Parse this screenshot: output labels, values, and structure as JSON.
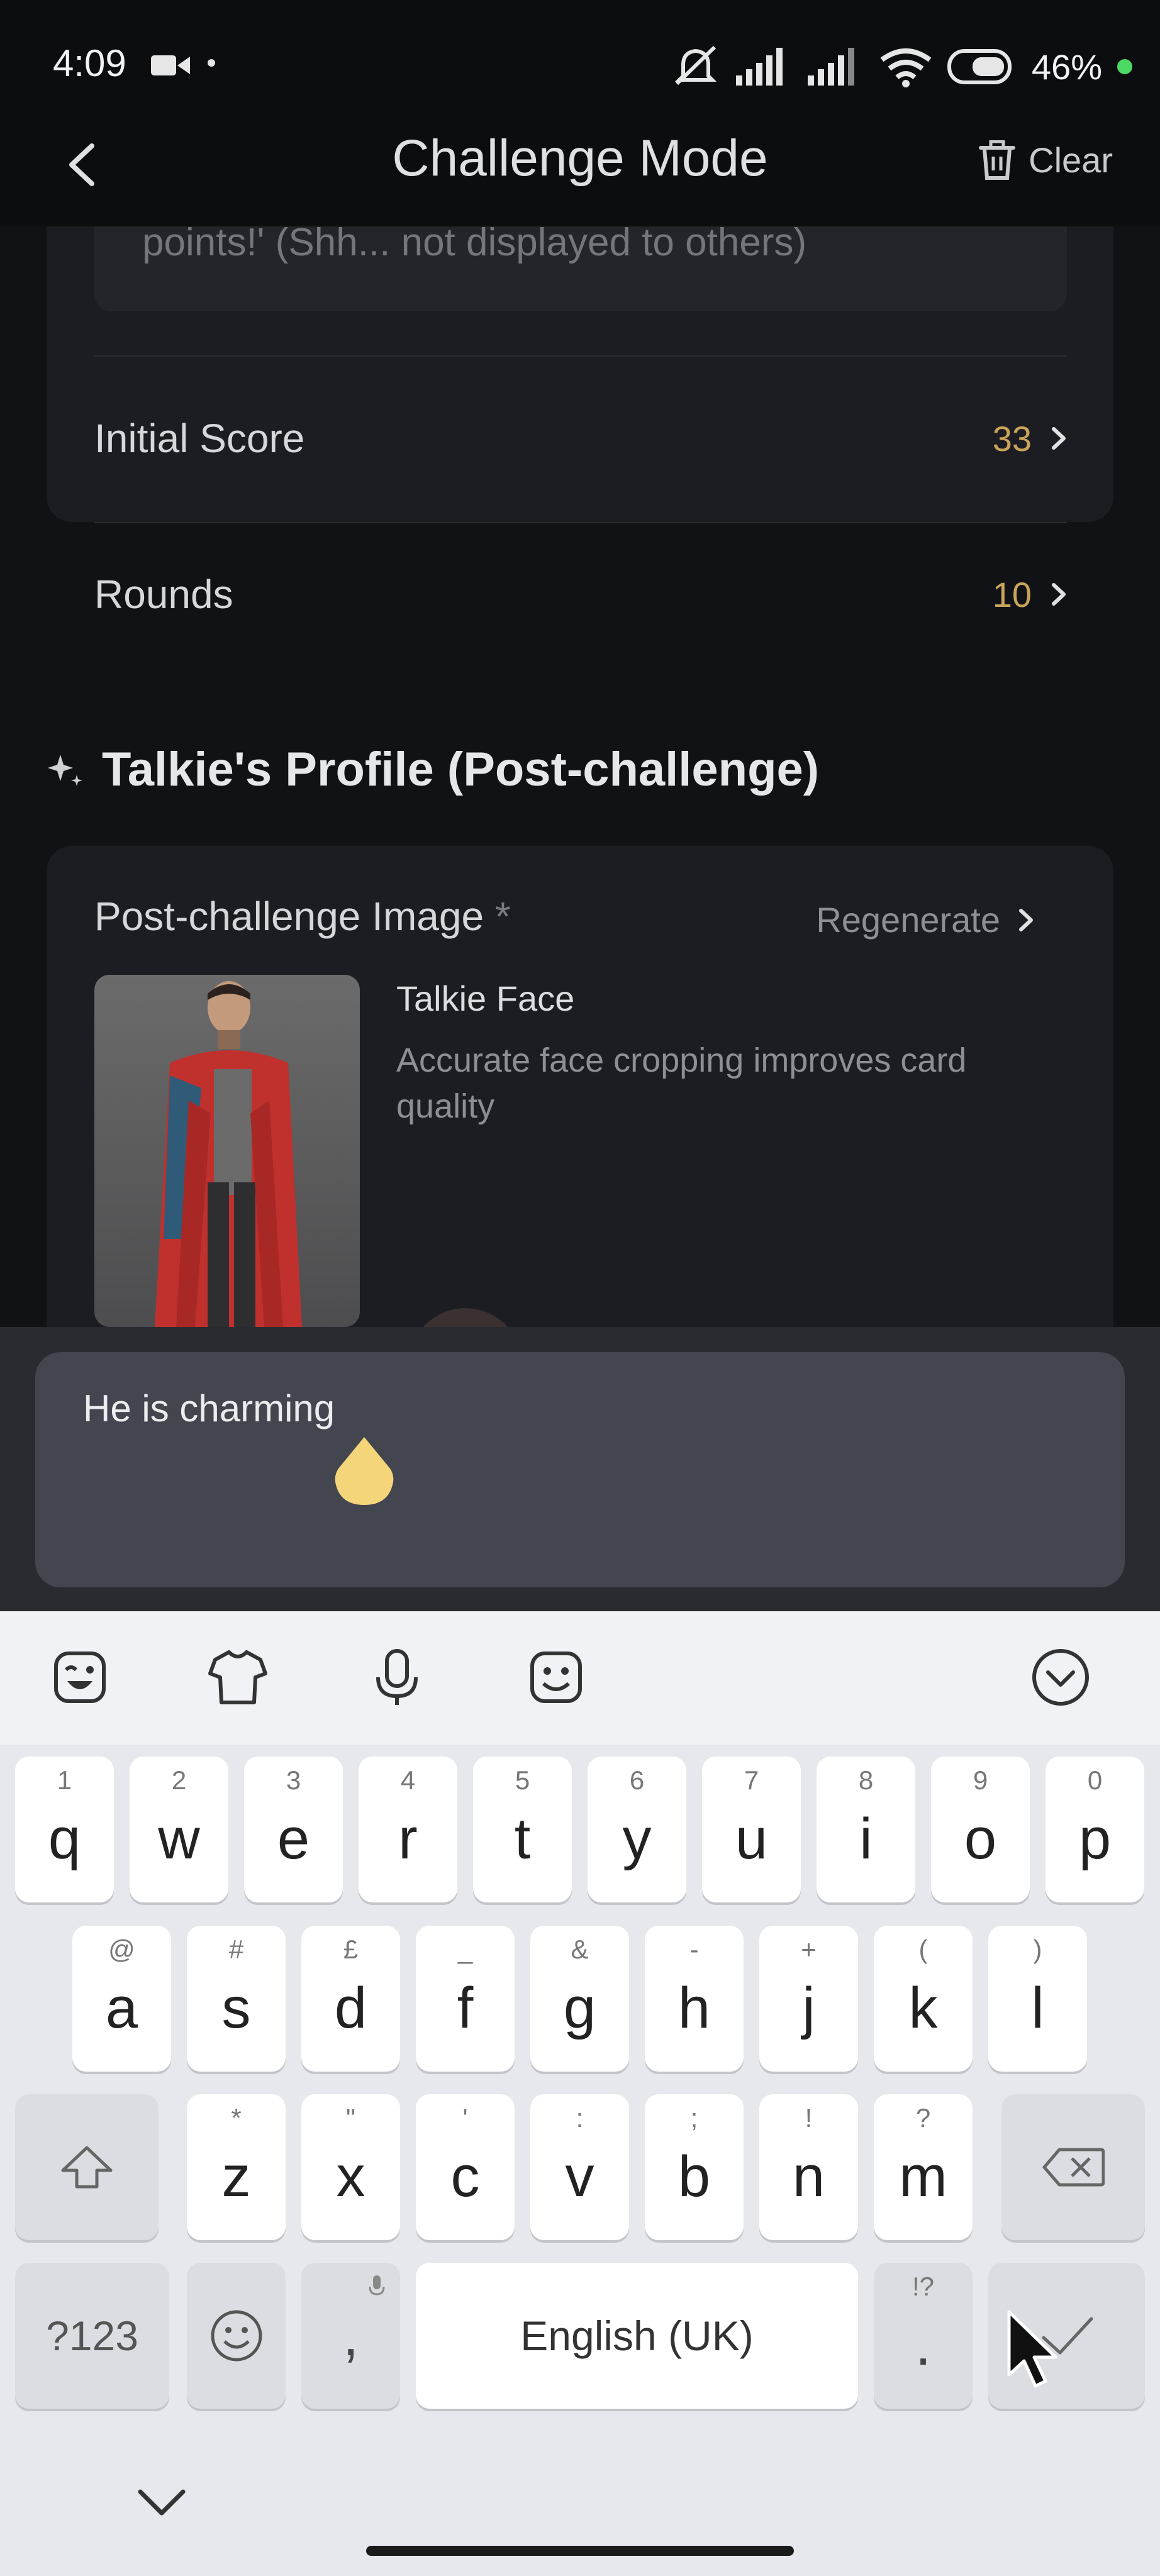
{
  "status_bar": {
    "time": "4:09",
    "battery": "46%",
    "icons": [
      "video-icon",
      "mute-icon",
      "signal-icon",
      "signal-icon",
      "wifi-icon",
      "battery-icon"
    ]
  },
  "header": {
    "title": "Challenge Mode",
    "clear_label": "Clear",
    "icons": [
      "back-icon",
      "trash-icon"
    ]
  },
  "content": {
    "hint_text": "points!' (Shh... not displayed to others)",
    "settings": [
      {
        "label": "Initial Score",
        "value": "33"
      },
      {
        "label": "Rounds",
        "value": "10"
      }
    ],
    "section_title": "Talkie's Profile (Post-challenge)",
    "post_challenge_image": {
      "label": "Post-challenge Image",
      "required_mark": "*",
      "regenerate_label": "Regenerate",
      "face_title": "Talkie Face",
      "face_description": "Accurate face cropping improves card quality"
    }
  },
  "input": {
    "value": "He is charming"
  },
  "keyboard": {
    "toolbar_icons": [
      "sticker-icon",
      "shirt-icon",
      "microphone-icon",
      "emoji-face-icon",
      "collapse-icon"
    ],
    "row1": [
      {
        "ch": "q",
        "sub": "1"
      },
      {
        "ch": "w",
        "sub": "2"
      },
      {
        "ch": "e",
        "sub": "3"
      },
      {
        "ch": "r",
        "sub": "4"
      },
      {
        "ch": "t",
        "sub": "5"
      },
      {
        "ch": "y",
        "sub": "6"
      },
      {
        "ch": "u",
        "sub": "7"
      },
      {
        "ch": "i",
        "sub": "8"
      },
      {
        "ch": "o",
        "sub": "9"
      },
      {
        "ch": "p",
        "sub": "0"
      }
    ],
    "row2": [
      {
        "ch": "a",
        "sub": "@"
      },
      {
        "ch": "s",
        "sub": "#"
      },
      {
        "ch": "d",
        "sub": "£"
      },
      {
        "ch": "f",
        "sub": "_"
      },
      {
        "ch": "g",
        "sub": "&"
      },
      {
        "ch": "h",
        "sub": "-"
      },
      {
        "ch": "j",
        "sub": "+"
      },
      {
        "ch": "k",
        "sub": "("
      },
      {
        "ch": "l",
        "sub": ")"
      }
    ],
    "row3": [
      {
        "ch": "z",
        "sub": "*"
      },
      {
        "ch": "x",
        "sub": "\""
      },
      {
        "ch": "c",
        "sub": "'"
      },
      {
        "ch": "v",
        "sub": ":"
      },
      {
        "ch": "b",
        "sub": ";"
      },
      {
        "ch": "n",
        "sub": "!"
      },
      {
        "ch": "m",
        "sub": "?"
      }
    ],
    "symbols_label": "?123",
    "comma": ",",
    "space_label": "English (UK)",
    "period": ".",
    "period_sub": "!?"
  }
}
